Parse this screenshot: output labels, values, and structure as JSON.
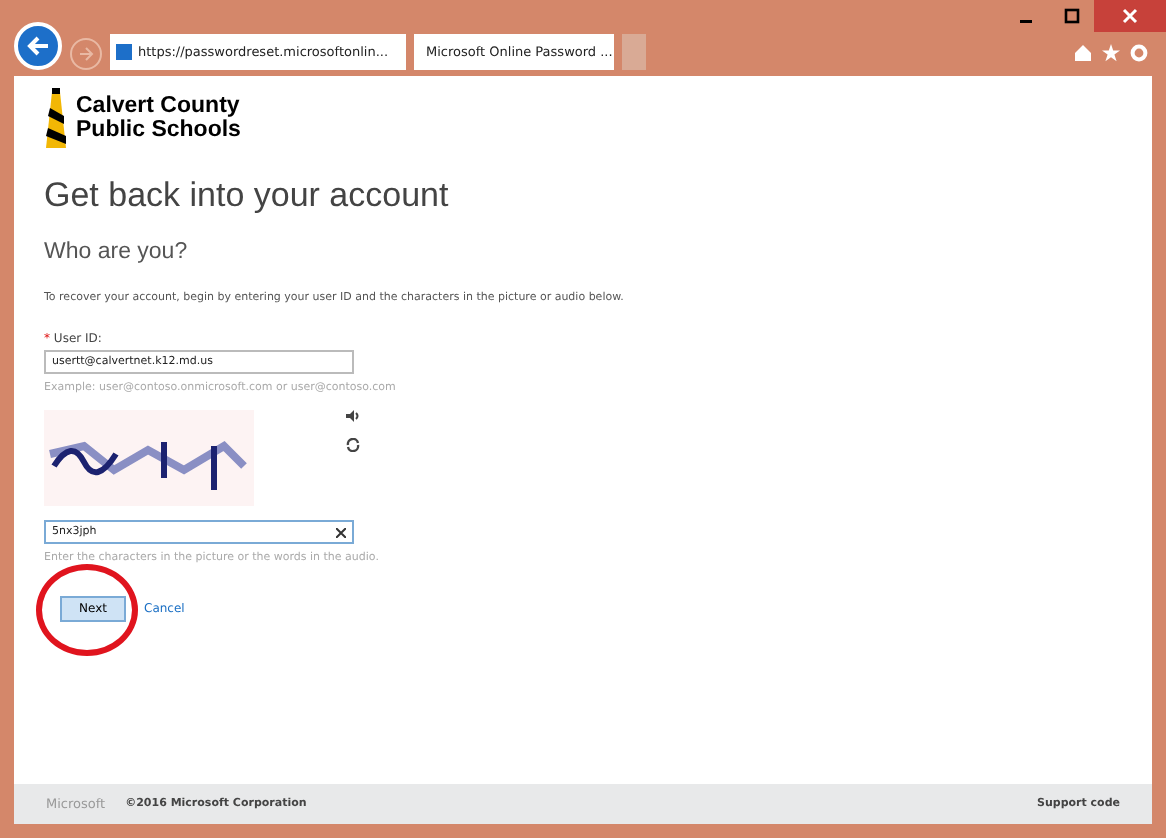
{
  "browser": {
    "address": "https://passwordreset.microsoftonlin...",
    "tab_title": "Microsoft Online Password ..."
  },
  "logo": {
    "line_1": "Calvert County",
    "line_2": "Public Schools"
  },
  "heading": "Get back into your account",
  "subheading": "Who are you?",
  "intro": "To recover your account, begin by entering your user ID and the characters in the picture or audio below.",
  "user_id": {
    "required_mark": "*",
    "label": "User ID:",
    "value": "usertt@calvertnet.k12.md.us",
    "hint": "Example: user@contoso.onmicrosoft.com or user@contoso.com"
  },
  "captcha": {
    "value": "5nx3jph",
    "hint": "Enter the characters in the picture or the words in the audio."
  },
  "buttons": {
    "next": "Next",
    "cancel": "Cancel"
  },
  "footer": {
    "brand": "Microsoft",
    "copyright": "©2016 Microsoft Corporation",
    "support": "Support code"
  }
}
